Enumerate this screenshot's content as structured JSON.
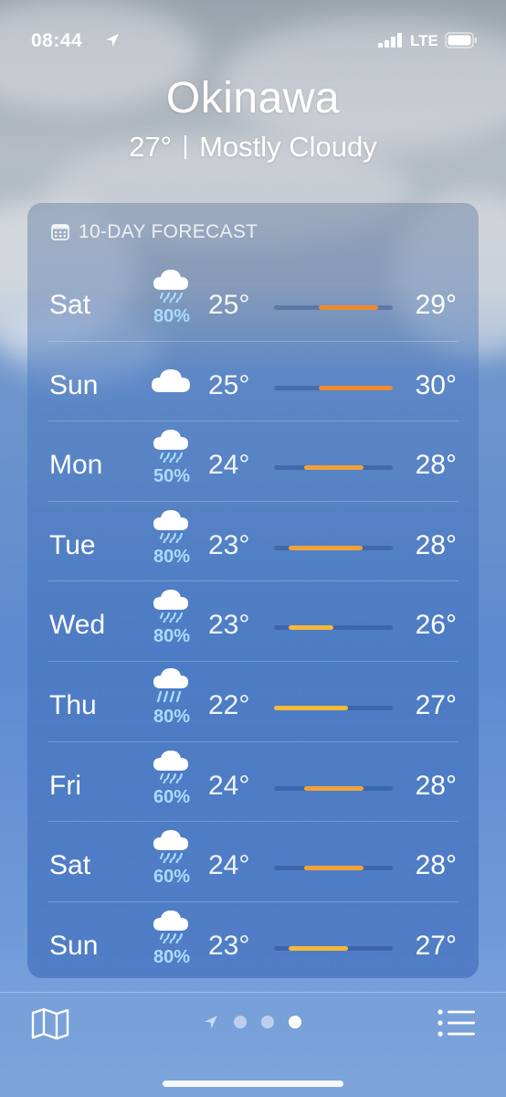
{
  "status_bar": {
    "time": "08:44",
    "network": "LTE",
    "icons": [
      "location-arrow-icon",
      "signal-icon",
      "battery-icon"
    ]
  },
  "header": {
    "city": "Okinawa",
    "current_temp": "27°",
    "condition": "Mostly Cloudy"
  },
  "forecast": {
    "title": "10-DAY FORECAST",
    "title_icon": "calendar-icon",
    "range_min": 22,
    "range_max": 30,
    "days": [
      {
        "day": "Sat",
        "icon": "cloud-rain-icon",
        "precip": "80%",
        "low": "25°",
        "high": "29°",
        "low_val": 25,
        "high_val": 29
      },
      {
        "day": "Sun",
        "icon": "cloud-icon",
        "precip": "",
        "low": "25°",
        "high": "30°",
        "low_val": 25,
        "high_val": 30
      },
      {
        "day": "Mon",
        "icon": "cloud-rain-icon",
        "precip": "50%",
        "low": "24°",
        "high": "28°",
        "low_val": 24,
        "high_val": 28
      },
      {
        "day": "Tue",
        "icon": "cloud-rain-icon",
        "precip": "80%",
        "low": "23°",
        "high": "28°",
        "low_val": 23,
        "high_val": 28
      },
      {
        "day": "Wed",
        "icon": "cloud-rain-icon",
        "precip": "80%",
        "low": "23°",
        "high": "26°",
        "low_val": 23,
        "high_val": 26
      },
      {
        "day": "Thu",
        "icon": "cloud-heavy-rain-icon",
        "precip": "80%",
        "low": "22°",
        "high": "27°",
        "low_val": 22,
        "high_val": 27
      },
      {
        "day": "Fri",
        "icon": "cloud-rain-icon",
        "precip": "60%",
        "low": "24°",
        "high": "28°",
        "low_val": 24,
        "high_val": 28
      },
      {
        "day": "Sat",
        "icon": "cloud-rain-icon",
        "precip": "60%",
        "low": "24°",
        "high": "28°",
        "low_val": 24,
        "high_val": 28
      },
      {
        "day": "Sun",
        "icon": "cloud-rain-icon",
        "precip": "80%",
        "low": "23°",
        "high": "27°",
        "low_val": 23,
        "high_val": 27
      }
    ]
  },
  "bottom_bar": {
    "icons": [
      "map-icon",
      "location-arrow-icon",
      "list-icon"
    ],
    "pages": 3,
    "active_page": 3
  },
  "colors": {
    "bar_warm": "#f0a23a",
    "bar_hot": "#ee8a2f",
    "bar_mild": "#f4b83a",
    "precip_text": "#a9dcff"
  }
}
